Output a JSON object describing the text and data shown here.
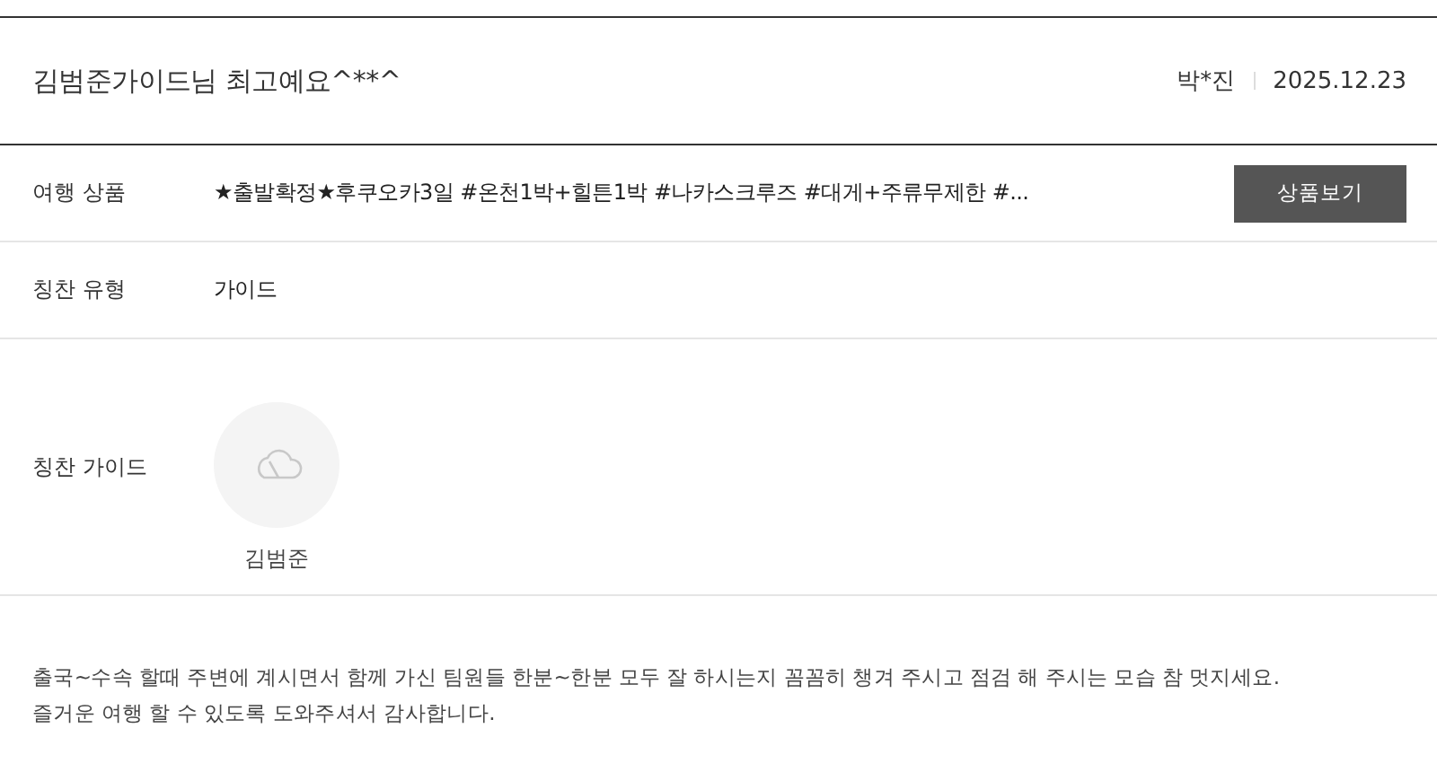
{
  "review": {
    "title": "김범준가이드님 최고예요^**^",
    "author": "박*진",
    "date": "2025.12.23"
  },
  "rows": [
    {
      "kind": "product",
      "label": "여행 상품",
      "value": "★출발확정★후쿠오카3일 #온천1박+힐튼1박 #나카스크루즈 #대게+주류무제한 #...",
      "button": "상품보기"
    },
    {
      "kind": "text",
      "label": "칭찬 유형",
      "value": "가이드"
    },
    {
      "kind": "guide",
      "label": "칭찬 가이드",
      "value": "김범준"
    }
  ],
  "body": [
    "출국~수속 할때 주변에 계시면서 함께 가신 팀원들 한분~한분 모두 잘 하시는지 꼼꼼히 챙겨 주시고 점검 해 주시는 모습 참 멋지세요.",
    "즐거운 여행 할 수 있도록 도와주셔서 감사합니다."
  ]
}
